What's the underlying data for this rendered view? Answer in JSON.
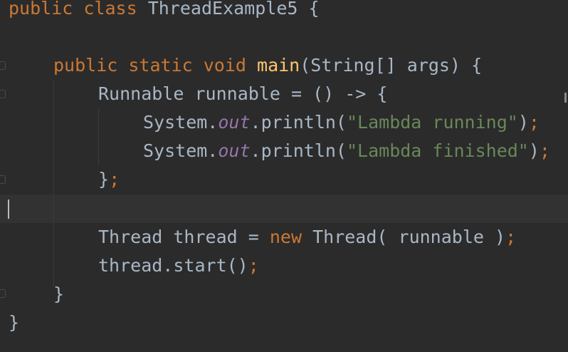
{
  "editor": {
    "lines": [
      {
        "kw1": "public",
        "kw2": "class",
        "name": "ThreadExample5",
        "brace": "{"
      },
      {
        "kw1": "public",
        "kw2": "static",
        "kw3": "void",
        "fn": "main",
        "params": "(String[] args)",
        "brace": "{"
      },
      {
        "type": "Runnable",
        "var": "runnable",
        "rest": "= () -> {"
      },
      {
        "obj": "System.",
        "field": "out",
        "call": ".println(",
        "str": "\"Lambda running\"",
        "close": ")",
        "semi": ";"
      },
      {
        "obj": "System.",
        "field": "out",
        "call": ".println(",
        "str": "\"Lambda finished\"",
        "close": ")",
        "semi": ";"
      },
      {
        "brace": "}",
        "semi": ";"
      },
      {
        "text": ""
      },
      {
        "type": "Thread",
        "var": "thread",
        "eq": "=",
        "kw": "new",
        "ctor": "Thread(",
        "arg": "runnable",
        "close": ")",
        "semi": ";"
      },
      {
        "call": "thread.start()",
        "semi": ";"
      },
      {
        "brace": "}"
      },
      {
        "brace": "}"
      }
    ]
  }
}
